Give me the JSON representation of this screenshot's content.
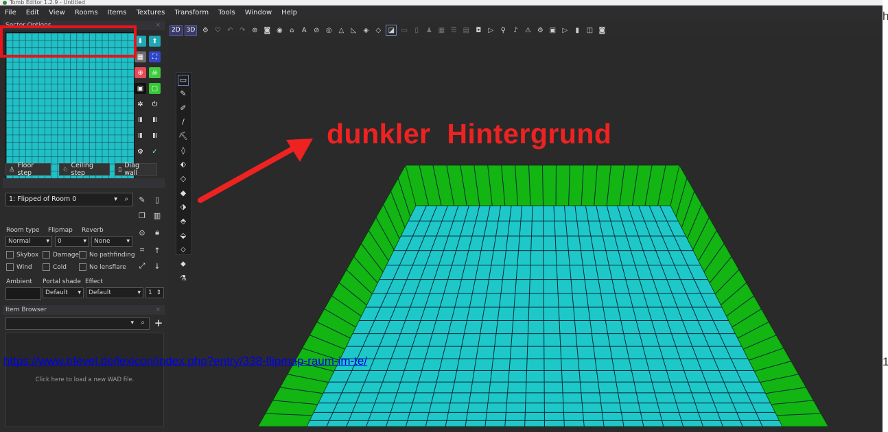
{
  "window": {
    "title": "Tomb Editor 1.2.9 - Untitled"
  },
  "menu": [
    "File",
    "Edit",
    "View",
    "Rooms",
    "Items",
    "Textures",
    "Transform",
    "Tools",
    "Window",
    "Help"
  ],
  "sector_options": {
    "title": "Sector Options",
    "buttons": {
      "floor_step": "Floor step",
      "ceiling_step": "Ceiling step",
      "diag_wall": "Diag wall"
    }
  },
  "room_options": {
    "selected_room": "1: Flipped of Room 0",
    "labels": {
      "room_type": "Room type",
      "flipmap": "Flipmap",
      "reverb": "Reverb",
      "ambient": "Ambient",
      "portal_shade": "Portal shade",
      "effect": "Effect"
    },
    "values": {
      "room_type": "Normal",
      "flipmap": "0",
      "reverb": "None",
      "portal_shade": "Default",
      "effect": "Default",
      "effect_level": "1"
    },
    "checkboxes": {
      "skybox": "Skybox",
      "damage": "Damage",
      "no_pathfinding": "No pathfinding",
      "wind": "Wind",
      "cold": "Cold",
      "no_lensflare": "No lensflare"
    }
  },
  "item_browser": {
    "title": "Item Browser",
    "hint": "Click here to load a new WAD file."
  },
  "toolbar": {
    "mode_2d": "2D",
    "mode_3d": "3D"
  },
  "annotation": {
    "text": "dunkler  Hintergrund",
    "color": "#ef2222"
  },
  "link": {
    "url": "https://www.trlevel.de/lexicon/index.php?entry/338-flipmap-raum-im-te/"
  },
  "edge": {
    "top": "h",
    "bottom": "1"
  },
  "colors": {
    "floor": "#1ec8c8",
    "walls": "#12b512",
    "highlight": "#e8141c"
  }
}
